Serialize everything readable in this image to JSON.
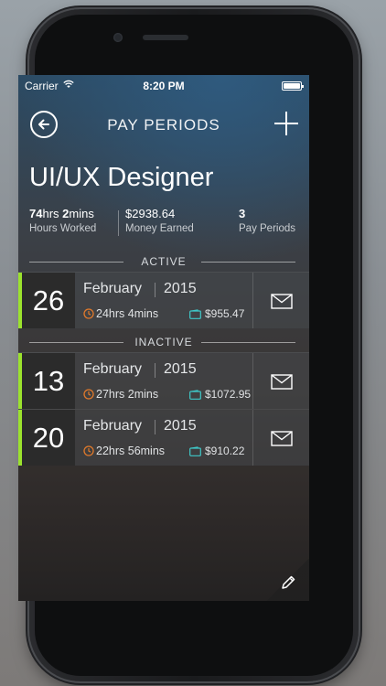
{
  "status_bar": {
    "carrier": "Carrier",
    "time": "8:20 PM",
    "wifi_icon": "wifi-icon",
    "battery_icon": "battery-icon"
  },
  "nav": {
    "title": "PAY PERIODS",
    "back_icon": "back-arrow-circle-icon",
    "add_icon": "plus-icon"
  },
  "job": {
    "title": "UI/UX Designer",
    "hours_worked": {
      "hours_value": "74",
      "hours_unit": "hrs ",
      "mins_value": "2",
      "mins_unit": "mins",
      "label": "Hours Worked"
    },
    "money_earned": {
      "value": "$2938.64",
      "label": "Money Earned"
    },
    "pay_periods": {
      "value": "3",
      "label": "Pay Periods"
    }
  },
  "sections": {
    "active_label": "ACTIVE",
    "inactive_label": "INACTIVE"
  },
  "active_periods": [
    {
      "day": "26",
      "month": "February",
      "year": "2015",
      "hours": "24hrs 4mins",
      "money": "$955.47"
    }
  ],
  "inactive_periods": [
    {
      "day": "13",
      "month": "February",
      "year": "2015",
      "hours": "27hrs 2mins",
      "money": "$1072.95"
    },
    {
      "day": "20",
      "month": "February",
      "year": "2015",
      "hours": "22hrs 56mins",
      "money": "$910.22"
    }
  ],
  "icons": {
    "clock": "clock-icon",
    "wallet": "wallet-icon",
    "mail": "mail-icon",
    "edit": "pencil-icon"
  },
  "colors": {
    "accent_green": "#9be22d",
    "clock_orange": "#e0792b",
    "wallet_teal": "#3fc9c9"
  }
}
